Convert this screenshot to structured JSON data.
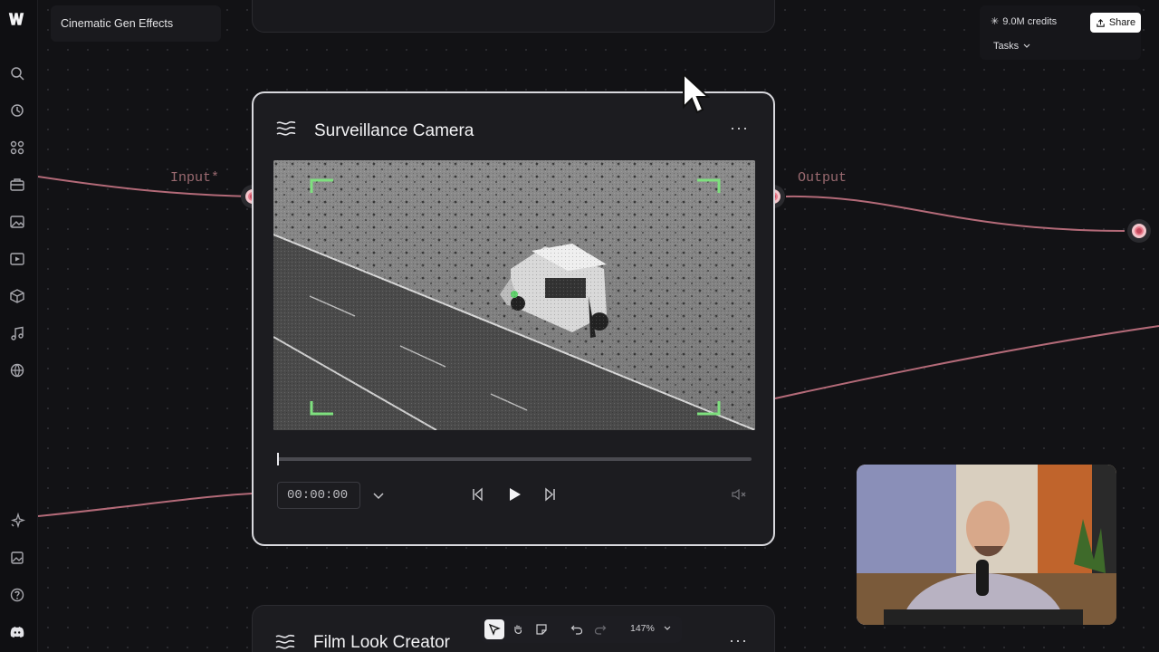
{
  "app": {
    "project_title": "Cinematic Gen Effects",
    "credits": "9.0M credits",
    "share_label": "Share",
    "tasks_label": "Tasks"
  },
  "sidebar": {
    "icons": [
      "logo-icon",
      "search-icon",
      "history-icon",
      "apps-icon",
      "briefcase-icon",
      "image-icon",
      "video-icon",
      "cube-icon",
      "music-icon",
      "globe-icon",
      "sparkle-icon",
      "gallery-icon",
      "help-icon",
      "discord-icon"
    ]
  },
  "node": {
    "title": "Surveillance Camera",
    "menu": "···",
    "input_label": "Input*",
    "output_label": "Output",
    "timecode": "00:00:00",
    "progress": 0.0
  },
  "node2": {
    "title": "Film Look Creator",
    "menu": "···"
  },
  "toolbar": {
    "zoom": "147%"
  },
  "colors": {
    "accent_port": "#e87a8a",
    "wire": "#b36a78",
    "frame_corner": "#7ee07e",
    "share_bg": "#ffffff"
  }
}
